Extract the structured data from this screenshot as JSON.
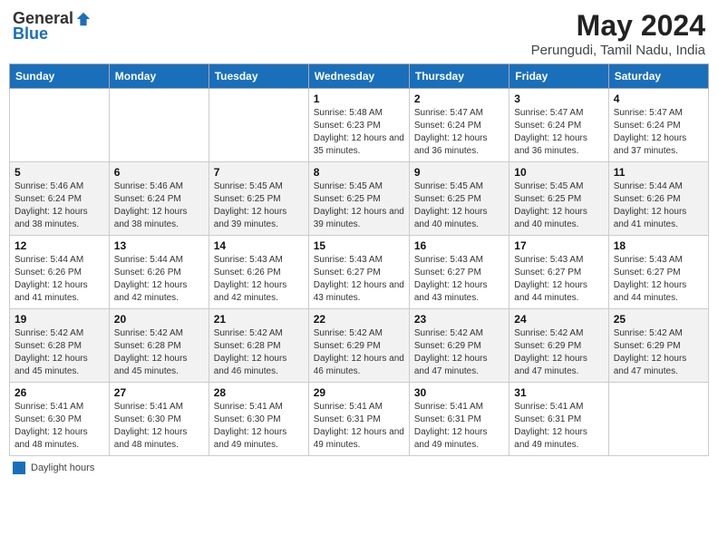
{
  "header": {
    "logo_general": "General",
    "logo_blue": "Blue",
    "month_year": "May 2024",
    "location": "Perungudi, Tamil Nadu, India"
  },
  "days_of_week": [
    "Sunday",
    "Monday",
    "Tuesday",
    "Wednesday",
    "Thursday",
    "Friday",
    "Saturday"
  ],
  "weeks": [
    [
      {
        "day": "",
        "sunrise": "",
        "sunset": "",
        "daylight": ""
      },
      {
        "day": "",
        "sunrise": "",
        "sunset": "",
        "daylight": ""
      },
      {
        "day": "",
        "sunrise": "",
        "sunset": "",
        "daylight": ""
      },
      {
        "day": "1",
        "sunrise": "Sunrise: 5:48 AM",
        "sunset": "Sunset: 6:23 PM",
        "daylight": "Daylight: 12 hours and 35 minutes."
      },
      {
        "day": "2",
        "sunrise": "Sunrise: 5:47 AM",
        "sunset": "Sunset: 6:24 PM",
        "daylight": "Daylight: 12 hours and 36 minutes."
      },
      {
        "day": "3",
        "sunrise": "Sunrise: 5:47 AM",
        "sunset": "Sunset: 6:24 PM",
        "daylight": "Daylight: 12 hours and 36 minutes."
      },
      {
        "day": "4",
        "sunrise": "Sunrise: 5:47 AM",
        "sunset": "Sunset: 6:24 PM",
        "daylight": "Daylight: 12 hours and 37 minutes."
      }
    ],
    [
      {
        "day": "5",
        "sunrise": "Sunrise: 5:46 AM",
        "sunset": "Sunset: 6:24 PM",
        "daylight": "Daylight: 12 hours and 38 minutes."
      },
      {
        "day": "6",
        "sunrise": "Sunrise: 5:46 AM",
        "sunset": "Sunset: 6:24 PM",
        "daylight": "Daylight: 12 hours and 38 minutes."
      },
      {
        "day": "7",
        "sunrise": "Sunrise: 5:45 AM",
        "sunset": "Sunset: 6:25 PM",
        "daylight": "Daylight: 12 hours and 39 minutes."
      },
      {
        "day": "8",
        "sunrise": "Sunrise: 5:45 AM",
        "sunset": "Sunset: 6:25 PM",
        "daylight": "Daylight: 12 hours and 39 minutes."
      },
      {
        "day": "9",
        "sunrise": "Sunrise: 5:45 AM",
        "sunset": "Sunset: 6:25 PM",
        "daylight": "Daylight: 12 hours and 40 minutes."
      },
      {
        "day": "10",
        "sunrise": "Sunrise: 5:45 AM",
        "sunset": "Sunset: 6:25 PM",
        "daylight": "Daylight: 12 hours and 40 minutes."
      },
      {
        "day": "11",
        "sunrise": "Sunrise: 5:44 AM",
        "sunset": "Sunset: 6:26 PM",
        "daylight": "Daylight: 12 hours and 41 minutes."
      }
    ],
    [
      {
        "day": "12",
        "sunrise": "Sunrise: 5:44 AM",
        "sunset": "Sunset: 6:26 PM",
        "daylight": "Daylight: 12 hours and 41 minutes."
      },
      {
        "day": "13",
        "sunrise": "Sunrise: 5:44 AM",
        "sunset": "Sunset: 6:26 PM",
        "daylight": "Daylight: 12 hours and 42 minutes."
      },
      {
        "day": "14",
        "sunrise": "Sunrise: 5:43 AM",
        "sunset": "Sunset: 6:26 PM",
        "daylight": "Daylight: 12 hours and 42 minutes."
      },
      {
        "day": "15",
        "sunrise": "Sunrise: 5:43 AM",
        "sunset": "Sunset: 6:27 PM",
        "daylight": "Daylight: 12 hours and 43 minutes."
      },
      {
        "day": "16",
        "sunrise": "Sunrise: 5:43 AM",
        "sunset": "Sunset: 6:27 PM",
        "daylight": "Daylight: 12 hours and 43 minutes."
      },
      {
        "day": "17",
        "sunrise": "Sunrise: 5:43 AM",
        "sunset": "Sunset: 6:27 PM",
        "daylight": "Daylight: 12 hours and 44 minutes."
      },
      {
        "day": "18",
        "sunrise": "Sunrise: 5:43 AM",
        "sunset": "Sunset: 6:27 PM",
        "daylight": "Daylight: 12 hours and 44 minutes."
      }
    ],
    [
      {
        "day": "19",
        "sunrise": "Sunrise: 5:42 AM",
        "sunset": "Sunset: 6:28 PM",
        "daylight": "Daylight: 12 hours and 45 minutes."
      },
      {
        "day": "20",
        "sunrise": "Sunrise: 5:42 AM",
        "sunset": "Sunset: 6:28 PM",
        "daylight": "Daylight: 12 hours and 45 minutes."
      },
      {
        "day": "21",
        "sunrise": "Sunrise: 5:42 AM",
        "sunset": "Sunset: 6:28 PM",
        "daylight": "Daylight: 12 hours and 46 minutes."
      },
      {
        "day": "22",
        "sunrise": "Sunrise: 5:42 AM",
        "sunset": "Sunset: 6:29 PM",
        "daylight": "Daylight: 12 hours and 46 minutes."
      },
      {
        "day": "23",
        "sunrise": "Sunrise: 5:42 AM",
        "sunset": "Sunset: 6:29 PM",
        "daylight": "Daylight: 12 hours and 47 minutes."
      },
      {
        "day": "24",
        "sunrise": "Sunrise: 5:42 AM",
        "sunset": "Sunset: 6:29 PM",
        "daylight": "Daylight: 12 hours and 47 minutes."
      },
      {
        "day": "25",
        "sunrise": "Sunrise: 5:42 AM",
        "sunset": "Sunset: 6:29 PM",
        "daylight": "Daylight: 12 hours and 47 minutes."
      }
    ],
    [
      {
        "day": "26",
        "sunrise": "Sunrise: 5:41 AM",
        "sunset": "Sunset: 6:30 PM",
        "daylight": "Daylight: 12 hours and 48 minutes."
      },
      {
        "day": "27",
        "sunrise": "Sunrise: 5:41 AM",
        "sunset": "Sunset: 6:30 PM",
        "daylight": "Daylight: 12 hours and 48 minutes."
      },
      {
        "day": "28",
        "sunrise": "Sunrise: 5:41 AM",
        "sunset": "Sunset: 6:30 PM",
        "daylight": "Daylight: 12 hours and 49 minutes."
      },
      {
        "day": "29",
        "sunrise": "Sunrise: 5:41 AM",
        "sunset": "Sunset: 6:31 PM",
        "daylight": "Daylight: 12 hours and 49 minutes."
      },
      {
        "day": "30",
        "sunrise": "Sunrise: 5:41 AM",
        "sunset": "Sunset: 6:31 PM",
        "daylight": "Daylight: 12 hours and 49 minutes."
      },
      {
        "day": "31",
        "sunrise": "Sunrise: 5:41 AM",
        "sunset": "Sunset: 6:31 PM",
        "daylight": "Daylight: 12 hours and 49 minutes."
      },
      {
        "day": "",
        "sunrise": "",
        "sunset": "",
        "daylight": ""
      }
    ]
  ],
  "footer": {
    "label": "Daylight hours"
  }
}
